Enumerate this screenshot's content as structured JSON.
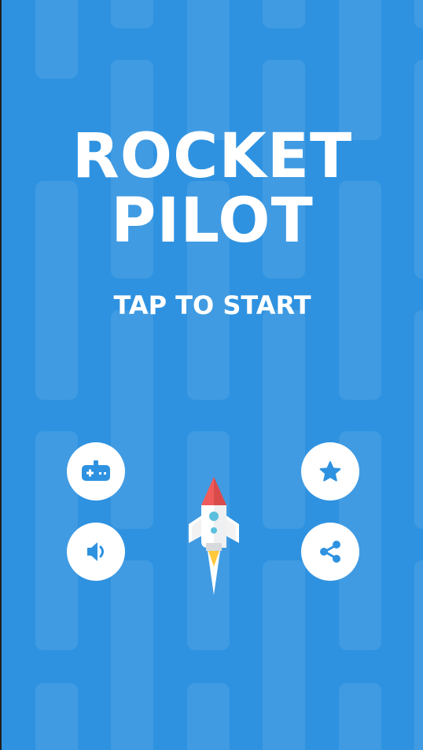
{
  "game": {
    "title_line1": "ROCKET",
    "title_line2": "PILOT",
    "prompt": "TAP TO START"
  },
  "buttons": {
    "games": "gamepad-icon",
    "sound": "speaker-icon",
    "rate": "star-icon",
    "share": "share-icon"
  },
  "colors": {
    "background": "#2e92e0",
    "button_face": "#ffffff",
    "icon": "#2e92e0",
    "rocket_nose": "#ef5b5b",
    "rocket_window": "#5bc0de",
    "rocket_flame": "#ffc83d"
  }
}
